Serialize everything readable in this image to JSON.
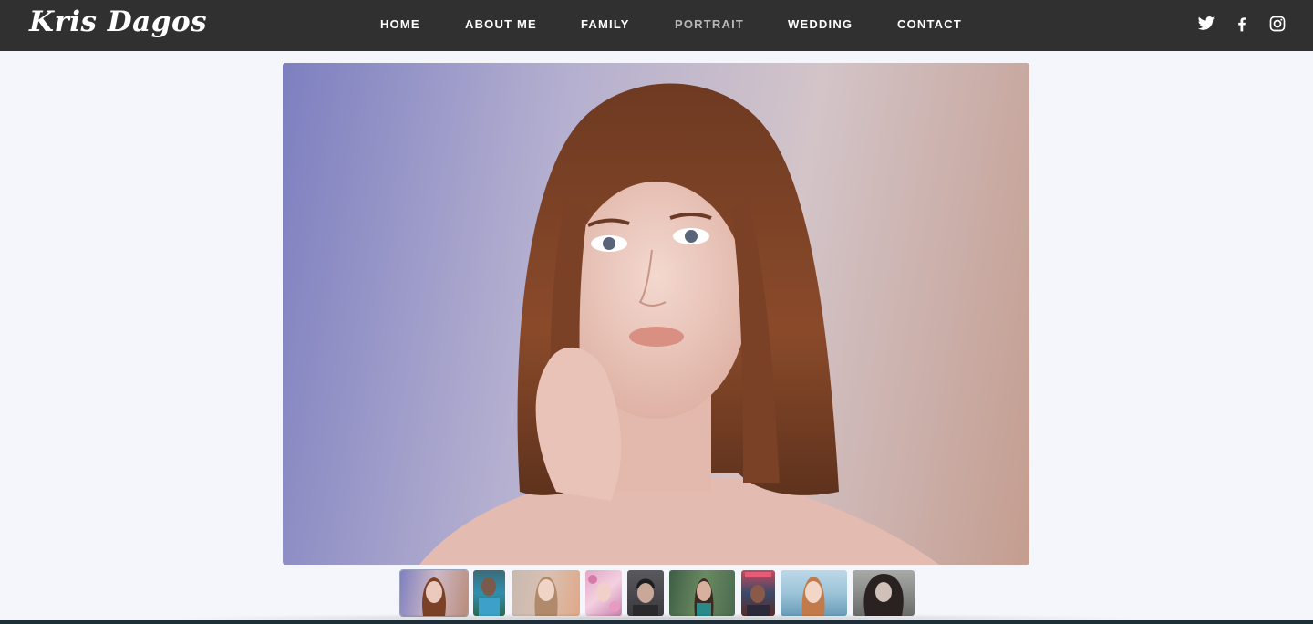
{
  "brand": {
    "logo_text": "Kris Dagos"
  },
  "nav": {
    "items": [
      {
        "label": "HOME",
        "active": false
      },
      {
        "label": "ABOUT ME",
        "active": false
      },
      {
        "label": "FAMILY",
        "active": false
      },
      {
        "label": "PORTRAIT",
        "active": true
      },
      {
        "label": "WEDDING",
        "active": false
      },
      {
        "label": "CONTACT",
        "active": false
      }
    ]
  },
  "social": {
    "icons": [
      "twitter-icon",
      "facebook-icon",
      "instagram-icon"
    ]
  },
  "gallery": {
    "selected_index": 0,
    "thumbnail_count": 9
  },
  "colors": {
    "header_bg": "#303030",
    "page_bg": "#f5f6fb",
    "nav_active": "#b8b8b8",
    "nav_text": "#ffffff"
  }
}
